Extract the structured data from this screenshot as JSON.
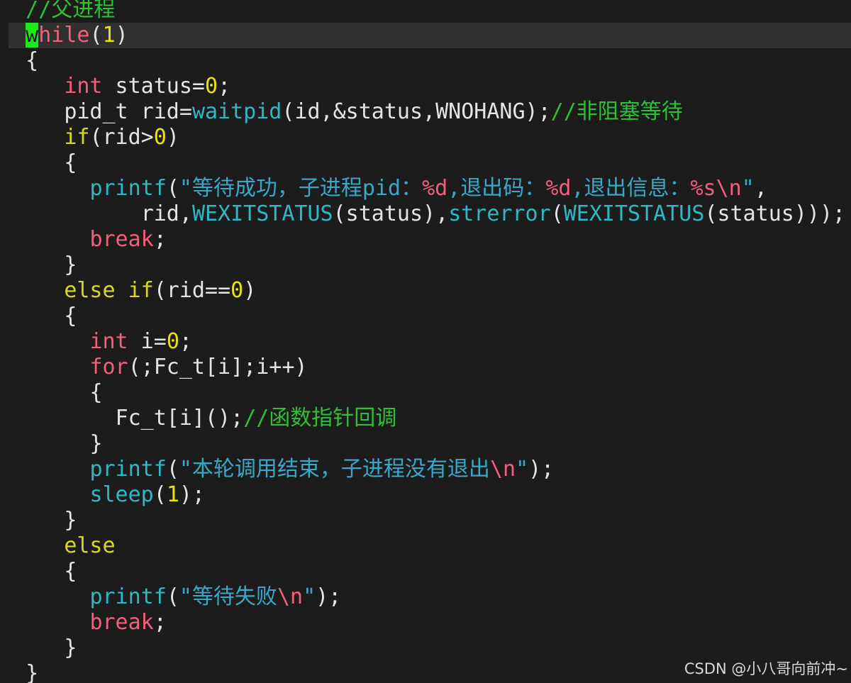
{
  "editor": {
    "lines": [
      {
        "indent": "  ",
        "tokens": [
          {
            "c": "cmt",
            "t": "//父进程"
          }
        ]
      },
      {
        "indent": "  ",
        "current": true,
        "tokens": [
          {
            "c": "cursor kw",
            "t": "w"
          },
          {
            "c": "kw",
            "t": "hile"
          },
          {
            "c": "plain",
            "t": "("
          },
          {
            "c": "num",
            "t": "1"
          },
          {
            "c": "plain",
            "t": ")"
          }
        ]
      },
      {
        "indent": "  ",
        "tokens": [
          {
            "c": "plain",
            "t": "{"
          }
        ]
      },
      {
        "indent": "     ",
        "tokens": [
          {
            "c": "kw",
            "t": "int"
          },
          {
            "c": "plain",
            "t": " status="
          },
          {
            "c": "num",
            "t": "0"
          },
          {
            "c": "plain",
            "t": ";"
          }
        ]
      },
      {
        "indent": "     ",
        "tokens": [
          {
            "c": "plain",
            "t": "pid_t rid="
          },
          {
            "c": "fn",
            "t": "waitpid"
          },
          {
            "c": "plain",
            "t": "(id,&status,WNOHANG);"
          },
          {
            "c": "cmt",
            "t": "//非阻塞等待"
          }
        ]
      },
      {
        "indent": "     ",
        "tokens": [
          {
            "c": "kw2",
            "t": "if"
          },
          {
            "c": "plain",
            "t": "(rid>"
          },
          {
            "c": "num",
            "t": "0"
          },
          {
            "c": "plain",
            "t": ")"
          }
        ]
      },
      {
        "indent": "     ",
        "tokens": [
          {
            "c": "plain",
            "t": "{"
          }
        ]
      },
      {
        "indent": "       ",
        "tokens": [
          {
            "c": "fn",
            "t": "printf"
          },
          {
            "c": "plain",
            "t": "("
          },
          {
            "c": "str",
            "t": "\"等待成功，子进程pid："
          },
          {
            "c": "fmt",
            "t": "%d"
          },
          {
            "c": "str",
            "t": ",退出码："
          },
          {
            "c": "fmt",
            "t": "%d"
          },
          {
            "c": "str",
            "t": ",退出信息："
          },
          {
            "c": "fmt",
            "t": "%s\\n"
          },
          {
            "c": "str",
            "t": "\""
          },
          {
            "c": "plain",
            "t": ","
          }
        ]
      },
      {
        "indent": "           ",
        "tokens": [
          {
            "c": "plain",
            "t": "rid,"
          },
          {
            "c": "fn",
            "t": "WEXITSTATUS"
          },
          {
            "c": "plain",
            "t": "(status),"
          },
          {
            "c": "fn",
            "t": "strerror"
          },
          {
            "c": "plain",
            "t": "("
          },
          {
            "c": "fn",
            "t": "WEXITSTATUS"
          },
          {
            "c": "plain",
            "t": "(status)));"
          }
        ]
      },
      {
        "indent": "       ",
        "tokens": [
          {
            "c": "kw",
            "t": "break"
          },
          {
            "c": "plain",
            "t": ";"
          }
        ]
      },
      {
        "indent": "     ",
        "tokens": [
          {
            "c": "plain",
            "t": "}"
          }
        ]
      },
      {
        "indent": "     ",
        "tokens": [
          {
            "c": "kw2",
            "t": "else if"
          },
          {
            "c": "plain",
            "t": "(rid=="
          },
          {
            "c": "num",
            "t": "0"
          },
          {
            "c": "plain",
            "t": ")"
          }
        ]
      },
      {
        "indent": "     ",
        "tokens": [
          {
            "c": "plain",
            "t": "{"
          }
        ]
      },
      {
        "indent": "       ",
        "tokens": [
          {
            "c": "kw",
            "t": "int"
          },
          {
            "c": "plain",
            "t": " i="
          },
          {
            "c": "num",
            "t": "0"
          },
          {
            "c": "plain",
            "t": ";"
          }
        ]
      },
      {
        "indent": "       ",
        "tokens": [
          {
            "c": "kw",
            "t": "for"
          },
          {
            "c": "plain",
            "t": "(;Fc_t[i];i++)"
          }
        ]
      },
      {
        "indent": "       ",
        "tokens": [
          {
            "c": "plain",
            "t": "{"
          }
        ]
      },
      {
        "indent": "         ",
        "tokens": [
          {
            "c": "plain",
            "t": "Fc_t[i]();"
          },
          {
            "c": "cmt",
            "t": "//函数指针回调"
          }
        ]
      },
      {
        "indent": "       ",
        "tokens": [
          {
            "c": "plain",
            "t": "}"
          }
        ]
      },
      {
        "indent": "       ",
        "tokens": [
          {
            "c": "fn",
            "t": "printf"
          },
          {
            "c": "plain",
            "t": "("
          },
          {
            "c": "str",
            "t": "\"本轮调用结束，子进程没有退出"
          },
          {
            "c": "fmt",
            "t": "\\n"
          },
          {
            "c": "str",
            "t": "\""
          },
          {
            "c": "plain",
            "t": ");"
          }
        ]
      },
      {
        "indent": "       ",
        "tokens": [
          {
            "c": "fn",
            "t": "sleep"
          },
          {
            "c": "plain",
            "t": "("
          },
          {
            "c": "num",
            "t": "1"
          },
          {
            "c": "plain",
            "t": ");"
          }
        ]
      },
      {
        "indent": "     ",
        "tokens": [
          {
            "c": "plain",
            "t": "}"
          }
        ]
      },
      {
        "indent": "     ",
        "tokens": [
          {
            "c": "kw2",
            "t": "else"
          }
        ]
      },
      {
        "indent": "     ",
        "tokens": [
          {
            "c": "plain",
            "t": "{"
          }
        ]
      },
      {
        "indent": "       ",
        "tokens": [
          {
            "c": "fn",
            "t": "printf"
          },
          {
            "c": "plain",
            "t": "("
          },
          {
            "c": "str",
            "t": "\"等待失败"
          },
          {
            "c": "fmt",
            "t": "\\n"
          },
          {
            "c": "str",
            "t": "\""
          },
          {
            "c": "plain",
            "t": ");"
          }
        ]
      },
      {
        "indent": "       ",
        "tokens": [
          {
            "c": "kw",
            "t": "break"
          },
          {
            "c": "plain",
            "t": ";"
          }
        ]
      },
      {
        "indent": "     ",
        "tokens": [
          {
            "c": "plain",
            "t": "}"
          }
        ]
      },
      {
        "indent": "  ",
        "tokens": [
          {
            "c": "plain",
            "t": "}"
          }
        ]
      }
    ]
  },
  "watermark": "CSDN @小八哥向前冲~",
  "colors": {
    "background": "#1c1c1c",
    "current_line": "#303030",
    "cursor": "#1fe81f",
    "keyword_red": "#f05f7b",
    "keyword_yellow": "#d7d72b",
    "number": "#e5e500",
    "function": "#2fb8c2",
    "string": "#3aa7c7",
    "comment": "#2fbf35"
  }
}
